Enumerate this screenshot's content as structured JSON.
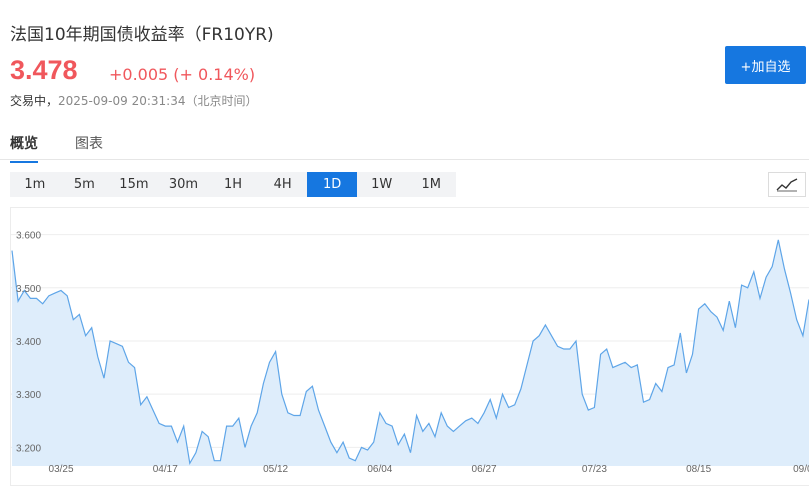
{
  "header": {
    "title": "法国10年期国债收益率（FR10YR)",
    "price": "3.478",
    "change": "+0.005 (+ 0.14%)",
    "status_label": "交易中，",
    "timestamp": "2025-09-09 20:31:34（北京时间）",
    "add_button": "+加自选"
  },
  "tabs": [
    {
      "label": "概览",
      "active": true
    },
    {
      "label": "图表",
      "active": false
    }
  ],
  "time_ranges": [
    {
      "label": "1m",
      "active": false
    },
    {
      "label": "5m",
      "active": false
    },
    {
      "label": "15m",
      "active": false
    },
    {
      "label": "30m",
      "active": false
    },
    {
      "label": "1H",
      "active": false
    },
    {
      "label": "4H",
      "active": false
    },
    {
      "label": "1D",
      "active": true
    },
    {
      "label": "1W",
      "active": false
    },
    {
      "label": "1M",
      "active": false
    }
  ],
  "colors": {
    "up": "#f0575c",
    "accent": "#1677e0",
    "line": "#5ea5e8",
    "fill": "#deedfb"
  },
  "icons": {
    "chart_type": "line-chart-icon"
  },
  "chart_data": {
    "type": "area",
    "ylim": [
      3.165,
      3.65
    ],
    "y_ticks": [
      "3.600",
      "3.500",
      "3.400",
      "3.300",
      "3.200"
    ],
    "y_tick_values": [
      3.6,
      3.5,
      3.4,
      3.3,
      3.2
    ],
    "x_ticks": [
      {
        "label": "03/25",
        "index": 8
      },
      {
        "label": "04/17",
        "index": 25
      },
      {
        "label": "05/12",
        "index": 43
      },
      {
        "label": "06/04",
        "index": 60
      },
      {
        "label": "06/27",
        "index": 77
      },
      {
        "label": "07/23",
        "index": 95
      },
      {
        "label": "08/15",
        "index": 112
      },
      {
        "label": "09/0",
        "index": 129
      }
    ],
    "values": [
      3.57,
      3.475,
      3.495,
      3.48,
      3.48,
      3.47,
      3.485,
      3.49,
      3.495,
      3.485,
      3.44,
      3.45,
      3.41,
      3.425,
      3.37,
      3.33,
      3.4,
      3.395,
      3.39,
      3.36,
      3.35,
      3.28,
      3.295,
      3.27,
      3.245,
      3.24,
      3.24,
      3.21,
      3.24,
      3.17,
      3.19,
      3.23,
      3.22,
      3.175,
      3.175,
      3.24,
      3.24,
      3.255,
      3.2,
      3.24,
      3.265,
      3.32,
      3.36,
      3.38,
      3.3,
      3.265,
      3.26,
      3.26,
      3.305,
      3.315,
      3.27,
      3.24,
      3.21,
      3.19,
      3.21,
      3.18,
      3.175,
      3.2,
      3.195,
      3.21,
      3.265,
      3.245,
      3.24,
      3.205,
      3.225,
      3.19,
      3.26,
      3.23,
      3.245,
      3.22,
      3.265,
      3.24,
      3.23,
      3.24,
      3.25,
      3.255,
      3.245,
      3.265,
      3.29,
      3.255,
      3.3,
      3.275,
      3.28,
      3.31,
      3.355,
      3.4,
      3.41,
      3.43,
      3.41,
      3.39,
      3.385,
      3.385,
      3.4,
      3.3,
      3.27,
      3.275,
      3.375,
      3.385,
      3.35,
      3.355,
      3.36,
      3.35,
      3.355,
      3.285,
      3.29,
      3.32,
      3.305,
      3.35,
      3.355,
      3.415,
      3.34,
      3.375,
      3.46,
      3.47,
      3.455,
      3.445,
      3.42,
      3.475,
      3.425,
      3.505,
      3.5,
      3.53,
      3.48,
      3.52,
      3.54,
      3.59,
      3.535,
      3.49,
      3.44,
      3.41,
      3.478
    ]
  }
}
